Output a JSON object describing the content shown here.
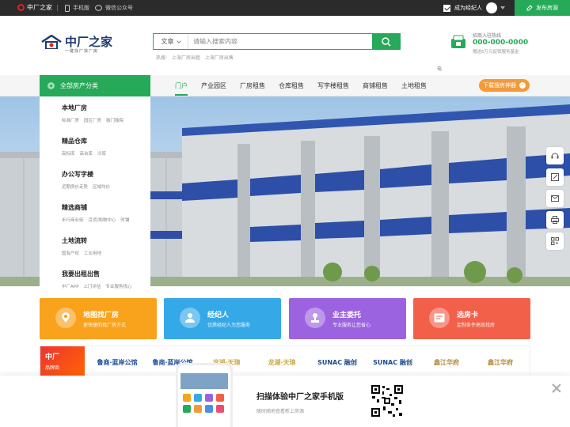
{
  "topbar": {
    "logo": "中厂之家",
    "links": [
      "手机版",
      "微信公众号"
    ],
    "broker": "成为经纪人",
    "publish": "发布房源"
  },
  "header": {
    "brand_name": "中厂之家",
    "slogan": "一键找厂找厂房",
    "search_type": "文章",
    "search_placeholder": "请输入搜索内容",
    "hot_label": "热搜:",
    "hot_items": [
      "上海厂房出租",
      "上海厂房出售"
    ],
    "hotline_title": "招商入驻热线",
    "hotline_number": "000-000-0000",
    "hotline_note": "赠送6万元促销服务基金",
    "hotline_side": "电"
  },
  "nav": {
    "category_button": "全部房产分类",
    "tabs": [
      "门户",
      "产业园区",
      "厂房租售",
      "仓库租售",
      "写字楼租售",
      "商铺租售",
      "土地租售"
    ],
    "active_tab": 0,
    "download": "下载搜房神器"
  },
  "categories": [
    {
      "title": "本地厂房",
      "subs": [
        "标准厂房",
        "园区厂房",
        "独门独院"
      ]
    },
    {
      "title": "精品仓库",
      "subs": [
        "高标库",
        "高台库",
        "冷库"
      ]
    },
    {
      "title": "办公写字楼",
      "subs": [
        "近期房价走势",
        "区域均价"
      ]
    },
    {
      "title": "精选商铺",
      "subs": [
        "步行商业街",
        "百货/购物中心",
        "时铺"
      ]
    },
    {
      "title": "土地流转",
      "subs": [
        "国有产权",
        "工业用地"
      ]
    },
    {
      "title": "我要出租出售",
      "subs": [
        "中厂APP",
        "上门评估",
        "专业服务找心"
      ]
    }
  ],
  "cards": [
    {
      "title": "地图找厂房",
      "desc": "更快捷的找厂房方式",
      "color": "#f9a21b",
      "icon": "map-pin-icon"
    },
    {
      "title": "经纪人",
      "desc": "优质经纪人为您服务",
      "color": "#35a9e8",
      "icon": "person-icon"
    },
    {
      "title": "业主委托",
      "desc": "专业服务让您省心",
      "color": "#9c63e0",
      "icon": "stamp-icon"
    },
    {
      "title": "选房卡",
      "desc": "定制条件高效找房",
      "color": "#f2604a",
      "icon": "card-icon"
    }
  ],
  "brands": {
    "lead_title": "中厂",
    "lead_sub": "品牌商",
    "logos": [
      {
        "name": "鲁商·蓝岸公馆",
        "color": "#1f4e9c"
      },
      {
        "name": "鲁商·蓝岸公馆",
        "color": "#1f4e9c"
      },
      {
        "name": "龙湖·天琅",
        "color": "#c9a640"
      },
      {
        "name": "龙湖·天琅",
        "color": "#c9a640"
      },
      {
        "name": "SUNAC 融创",
        "color": "#1a4a8a"
      },
      {
        "name": "SUNAC 融创",
        "color": "#1a4a8a"
      },
      {
        "name": "鑫江华府",
        "color": "#b08a3a"
      },
      {
        "name": "鑫江华府",
        "color": "#b08a3a"
      }
    ]
  },
  "overlay": {
    "title": "扫描体验中厂之家手机版",
    "subtitle": "随时随地查看新上房源"
  }
}
